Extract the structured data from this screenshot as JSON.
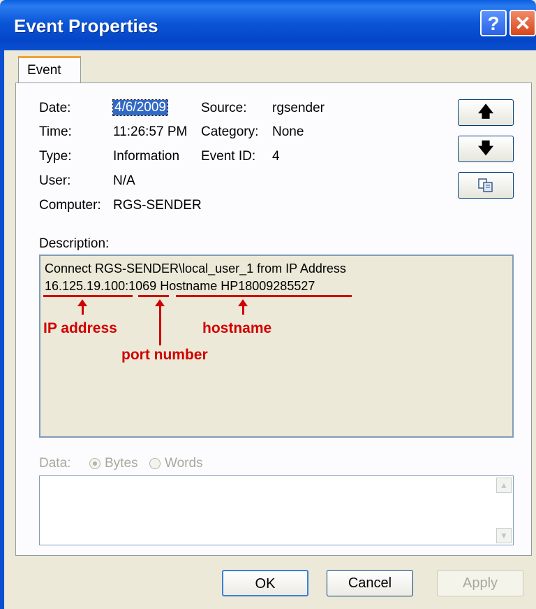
{
  "window": {
    "title": "Event Properties",
    "help_glyph": "?",
    "close_glyph": "✕"
  },
  "tabs": [
    "Event"
  ],
  "fields": {
    "date_label": "Date:",
    "date_value": "4/6/2009",
    "time_label": "Time:",
    "time_value": "11:26:57 PM",
    "type_label": "Type:",
    "type_value": "Information",
    "user_label": "User:",
    "user_value": "N/A",
    "computer_label": "Computer:",
    "computer_value": "RGS-SENDER",
    "source_label": "Source:",
    "source_value": "rgsender",
    "category_label": "Category:",
    "category_value": "None",
    "eventid_label": "Event ID:",
    "eventid_value": "4"
  },
  "side_buttons": {
    "up_glyph": "🡅",
    "down_glyph": "🡇",
    "copy_icon": "copy-icon"
  },
  "description": {
    "label": "Description:",
    "line1": "Connect RGS-SENDER\\local_user_1 from IP Address",
    "ip": "16.125.19.100",
    "colon": ":",
    "port": "1069",
    "host_prefix": " Hostname ",
    "hostname": "HP18009285527"
  },
  "annotations": {
    "ip_label": "IP address",
    "port_label": "port number",
    "host_label": "hostname",
    "color": "#d10000"
  },
  "data_section": {
    "label": "Data:",
    "option_bytes": "Bytes",
    "option_words": "Words",
    "selected": "Bytes"
  },
  "buttons": {
    "ok": "OK",
    "cancel": "Cancel",
    "apply": "Apply"
  },
  "colors": {
    "titlebar": "#0a4fd0",
    "dialog_bg": "#ece9d8",
    "selection": "#316ac5",
    "annotation": "#d10000"
  }
}
